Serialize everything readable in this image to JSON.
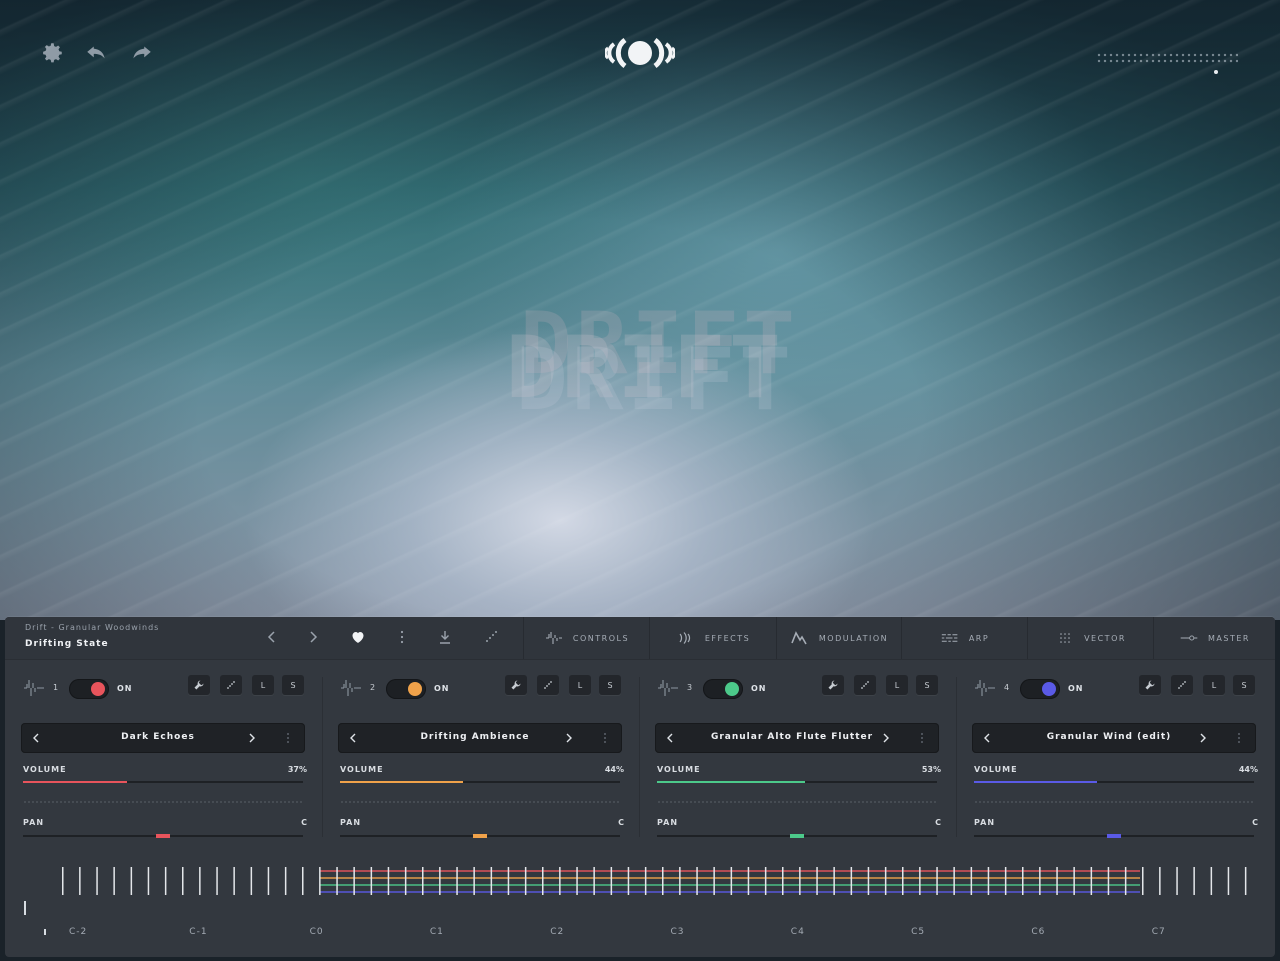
{
  "top": {
    "settings_icon": "gear-icon",
    "undo_icon": "undo-icon",
    "redo_icon": "redo-icon",
    "logo": "brand-logo",
    "title_art": "DRIFT"
  },
  "preset": {
    "subtitle": "Drift - Granular Woodwinds",
    "name": "Drifting State"
  },
  "tabs": [
    {
      "label": "CONTROLS",
      "icon": "waveform-icon"
    },
    {
      "label": "EFFECTS",
      "icon": "effects-icon"
    },
    {
      "label": "MODULATION",
      "icon": "modulation-icon"
    },
    {
      "label": "ARP",
      "icon": "arp-icon"
    },
    {
      "label": "VECTOR",
      "icon": "vector-icon"
    },
    {
      "label": "MASTER",
      "icon": "master-icon"
    }
  ],
  "layers": [
    {
      "num": "1",
      "on_label": "ON",
      "color": "#e8545c",
      "sound": "Dark Echoes",
      "volume_label": "VOLUME",
      "volume": "37%",
      "volume_frac": 0.37,
      "pan_label": "PAN",
      "pan": "C",
      "btn_l": "L",
      "btn_s": "S"
    },
    {
      "num": "2",
      "on_label": "ON",
      "color": "#f0a24a",
      "sound": "Drifting Ambience",
      "volume_label": "VOLUME",
      "volume": "44%",
      "volume_frac": 0.44,
      "pan_label": "PAN",
      "pan": "C",
      "btn_l": "L",
      "btn_s": "S"
    },
    {
      "num": "3",
      "on_label": "ON",
      "color": "#4cc98a",
      "sound": "Granular Alto Flute Flutter",
      "volume_label": "VOLUME",
      "volume": "53%",
      "volume_frac": 0.53,
      "pan_label": "PAN",
      "pan": "C",
      "btn_l": "L",
      "btn_s": "S"
    },
    {
      "num": "4",
      "on_label": "ON",
      "color": "#5a5ae6",
      "sound": "Granular Wind (edit)",
      "volume_label": "VOLUME",
      "volume": "44%",
      "volume_frac": 0.44,
      "pan_label": "PAN",
      "pan": "C",
      "btn_l": "L",
      "btn_s": "S"
    }
  ],
  "keyboard": {
    "octaves": [
      "C-2",
      "C-1",
      "C0",
      "C1",
      "C2",
      "C3",
      "C4",
      "C5",
      "C6",
      "C7"
    ]
  }
}
